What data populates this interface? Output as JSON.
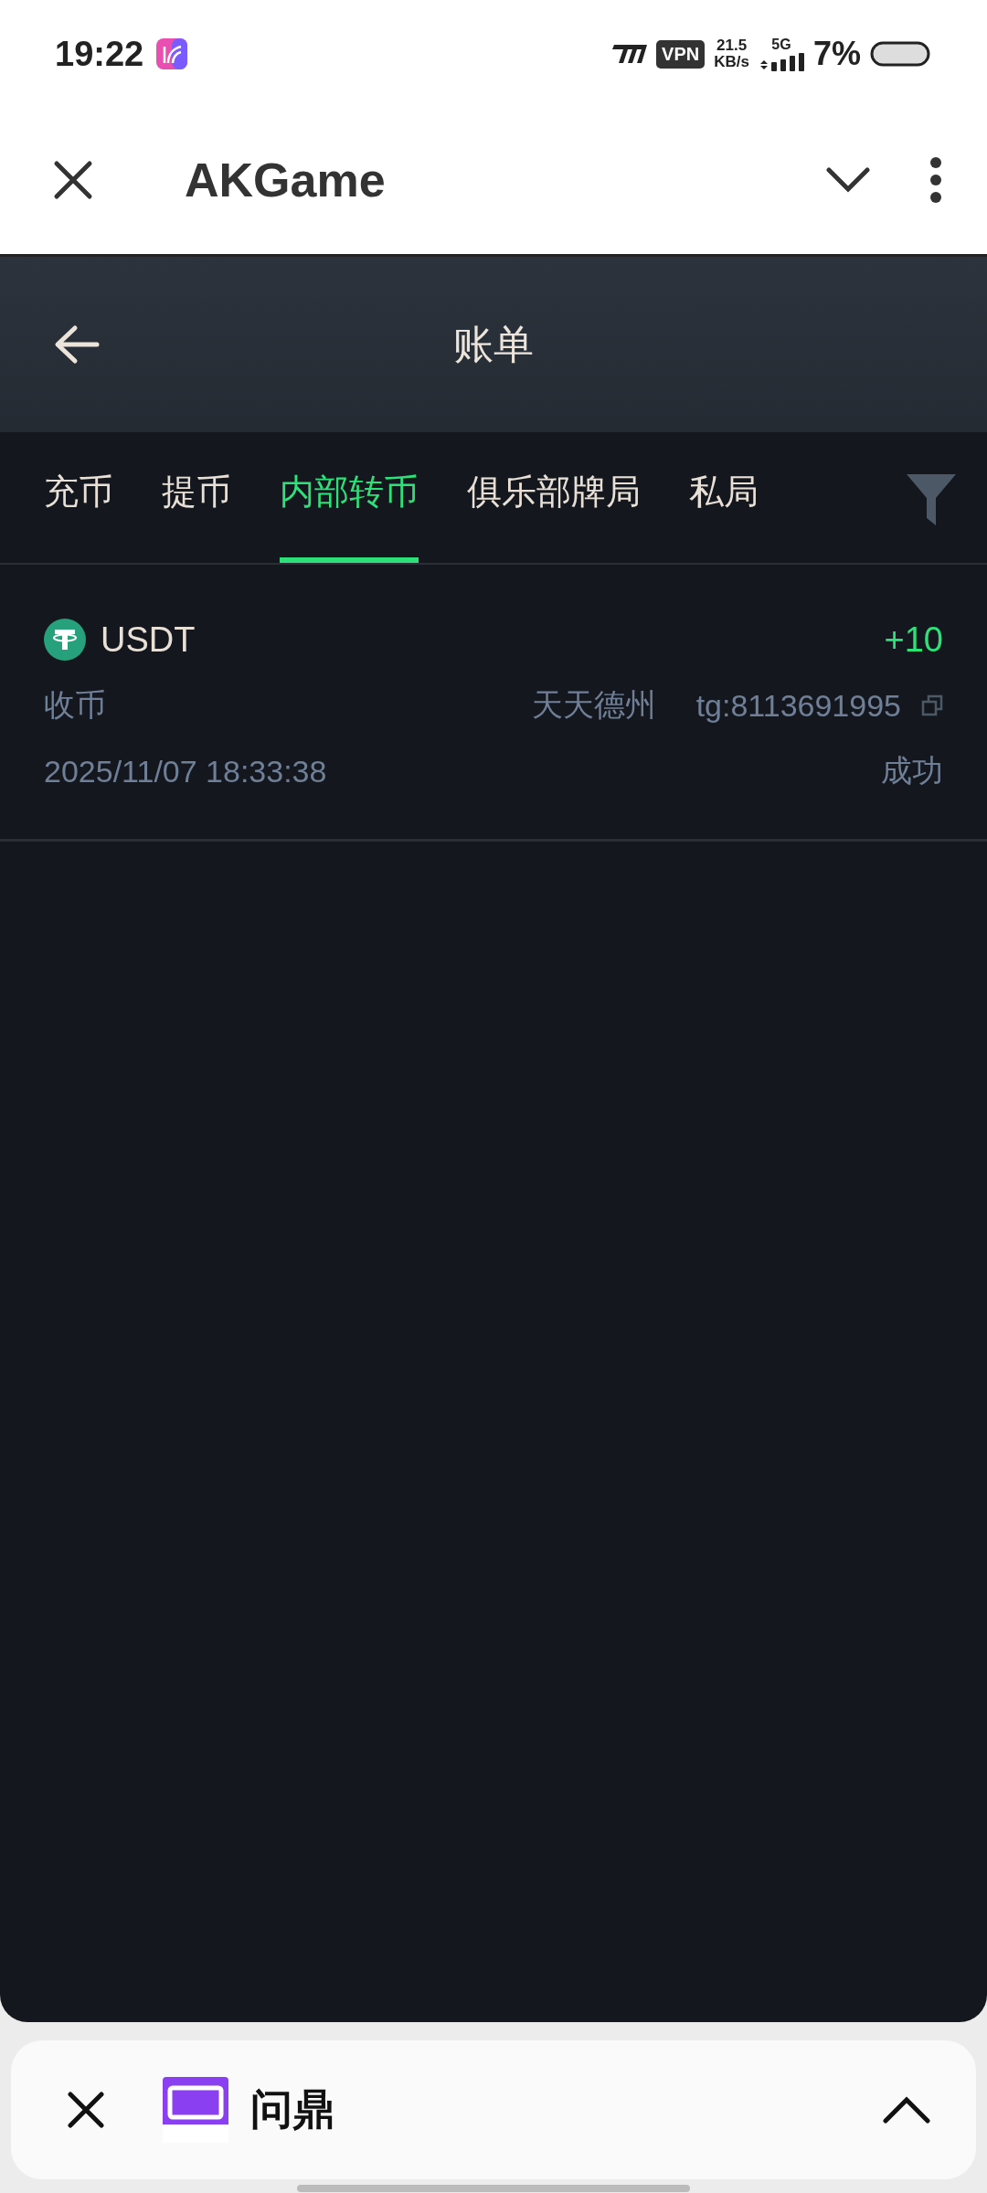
{
  "status_bar": {
    "time": "19:22",
    "vpn": "VPN",
    "net_speed": "21.5",
    "net_unit": "KB/s",
    "network": "5G",
    "battery": "7%"
  },
  "browser_bar": {
    "title": "AKGame"
  },
  "page": {
    "title": "账单"
  },
  "tabs": [
    {
      "label": "充币",
      "selected": false
    },
    {
      "label": "提币",
      "selected": false
    },
    {
      "label": "内部转币",
      "selected": true
    },
    {
      "label": "俱乐部牌局",
      "selected": false
    },
    {
      "label": "私局",
      "selected": false
    }
  ],
  "records": [
    {
      "currency": "USDT",
      "amount": "+10",
      "type": "收币",
      "club": "天天德州",
      "account": "tg:8113691995",
      "time": "2025/11/07 18:33:38",
      "status": "成功"
    }
  ],
  "mini_app": {
    "name": "问鼎"
  }
}
